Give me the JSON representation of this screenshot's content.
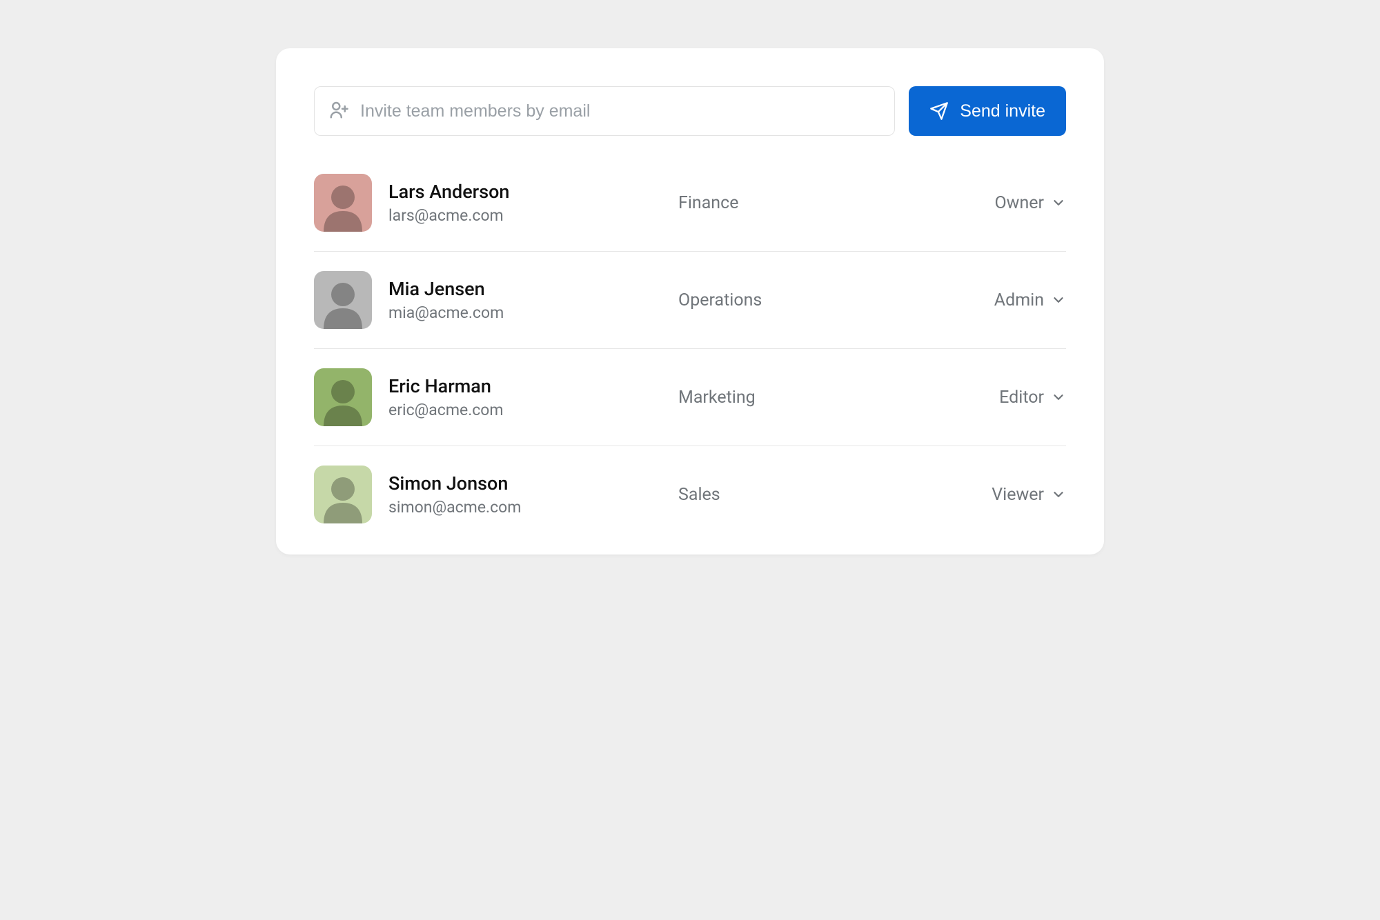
{
  "invite": {
    "placeholder": "Invite team members by email",
    "button_label": "Send invite"
  },
  "members": [
    {
      "name": "Lars Anderson",
      "email": "lars@acme.com",
      "department": "Finance",
      "role": "Owner",
      "avatar_bg": "#d8a19a"
    },
    {
      "name": "Mia Jensen",
      "email": "mia@acme.com",
      "department": "Operations",
      "role": "Admin",
      "avatar_bg": "#b8b8b8"
    },
    {
      "name": "Eric Harman",
      "email": "eric@acme.com",
      "department": "Marketing",
      "role": "Editor",
      "avatar_bg": "#93b46a"
    },
    {
      "name": "Simon Jonson",
      "email": "simon@acme.com",
      "department": "Sales",
      "role": "Viewer",
      "avatar_bg": "#c6d8a8"
    }
  ],
  "colors": {
    "primary": "#0a67d3",
    "text": "#111111",
    "muted": "#70757a",
    "border": "#e6e6e6",
    "page_bg": "#eeeeee",
    "card_bg": "#ffffff"
  }
}
